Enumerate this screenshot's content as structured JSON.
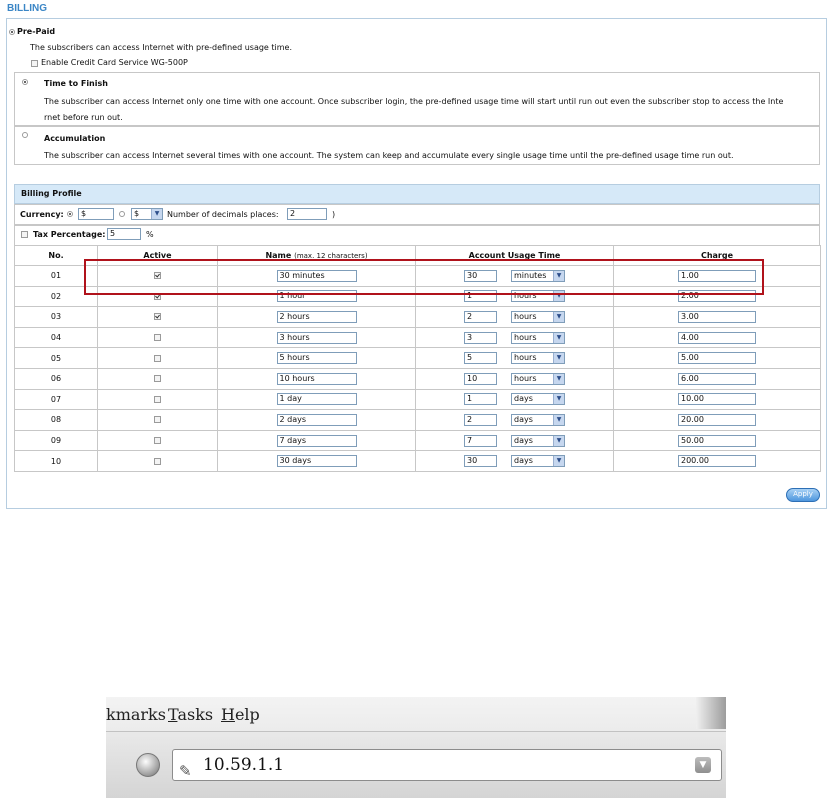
{
  "title": "BILLING",
  "prepaid": {
    "label": "Pre-Paid",
    "description": "The subscribers can access Internet with pre-defined usage time.",
    "credit_card_label": "Enable Credit Card Service WG-500P",
    "options": [
      {
        "title": "Time to Finish",
        "selected": true,
        "description_line1": "The subscriber can access Internet only one time with one account. Once subscriber login, the pre-defined usage time will start until run out even the subscriber stop to access the Inte",
        "description_line2": "rnet before run out."
      },
      {
        "title": "Accumulation",
        "selected": false,
        "description_line1": "The subscriber can access Internet several times with one account. The system can keep and accumulate every single usage time until the pre-defined usage time run out."
      }
    ]
  },
  "billing_profile": {
    "header": "Billing Profile",
    "currency_label": "Currency:",
    "currency_value": "$",
    "currency_select": "$",
    "decimals_label": "Number of decimals places:",
    "decimals_value": "2",
    "decimals_close": ")",
    "tax_label": "Tax Percentage:",
    "tax_value": "5",
    "tax_unit": "%",
    "columns": {
      "no": "No.",
      "active": "Active",
      "name": "Name",
      "name_hint": "(max. 12 characters)",
      "usage": "Account Usage Time",
      "charge": "Charge"
    },
    "rows": [
      {
        "no": "01",
        "active": true,
        "name": "30 minutes",
        "time": "30",
        "unit": "minutes",
        "charge": "1.00"
      },
      {
        "no": "02",
        "active": true,
        "name": "1 hour",
        "time": "1",
        "unit": "hours",
        "charge": "2.00"
      },
      {
        "no": "03",
        "active": true,
        "name": "2 hours",
        "time": "2",
        "unit": "hours",
        "charge": "3.00"
      },
      {
        "no": "04",
        "active": false,
        "name": "3 hours",
        "time": "3",
        "unit": "hours",
        "charge": "4.00"
      },
      {
        "no": "05",
        "active": false,
        "name": "5 hours",
        "time": "5",
        "unit": "hours",
        "charge": "5.00"
      },
      {
        "no": "06",
        "active": false,
        "name": "10 hours",
        "time": "10",
        "unit": "hours",
        "charge": "6.00"
      },
      {
        "no": "07",
        "active": false,
        "name": "1 day",
        "time": "1",
        "unit": "days",
        "charge": "10.00"
      },
      {
        "no": "08",
        "active": false,
        "name": "2 days",
        "time": "2",
        "unit": "days",
        "charge": "20.00"
      },
      {
        "no": "09",
        "active": false,
        "name": "7 days",
        "time": "7",
        "unit": "days",
        "charge": "50.00"
      },
      {
        "no": "10",
        "active": false,
        "name": "30 days",
        "time": "30",
        "unit": "days",
        "charge": "200.00"
      }
    ]
  },
  "apply_label": "Apply",
  "browser": {
    "menu_bookmarks_partial": "kmarks",
    "menu_tasks_t": "T",
    "menu_tasks_rest": "asks",
    "menu_help_h": "H",
    "menu_help_rest": "elp",
    "url": "10.59.1.1",
    "url_icon": "pencil-icon",
    "go_icon": "circle-button-icon",
    "dropdown_icon": "chevron-down-icon"
  },
  "colors": {
    "title": "#3b86c6",
    "profile_header_bg": "#d6e9f8",
    "highlight_border": "#b0121b",
    "apply_button": "#4e97de"
  }
}
